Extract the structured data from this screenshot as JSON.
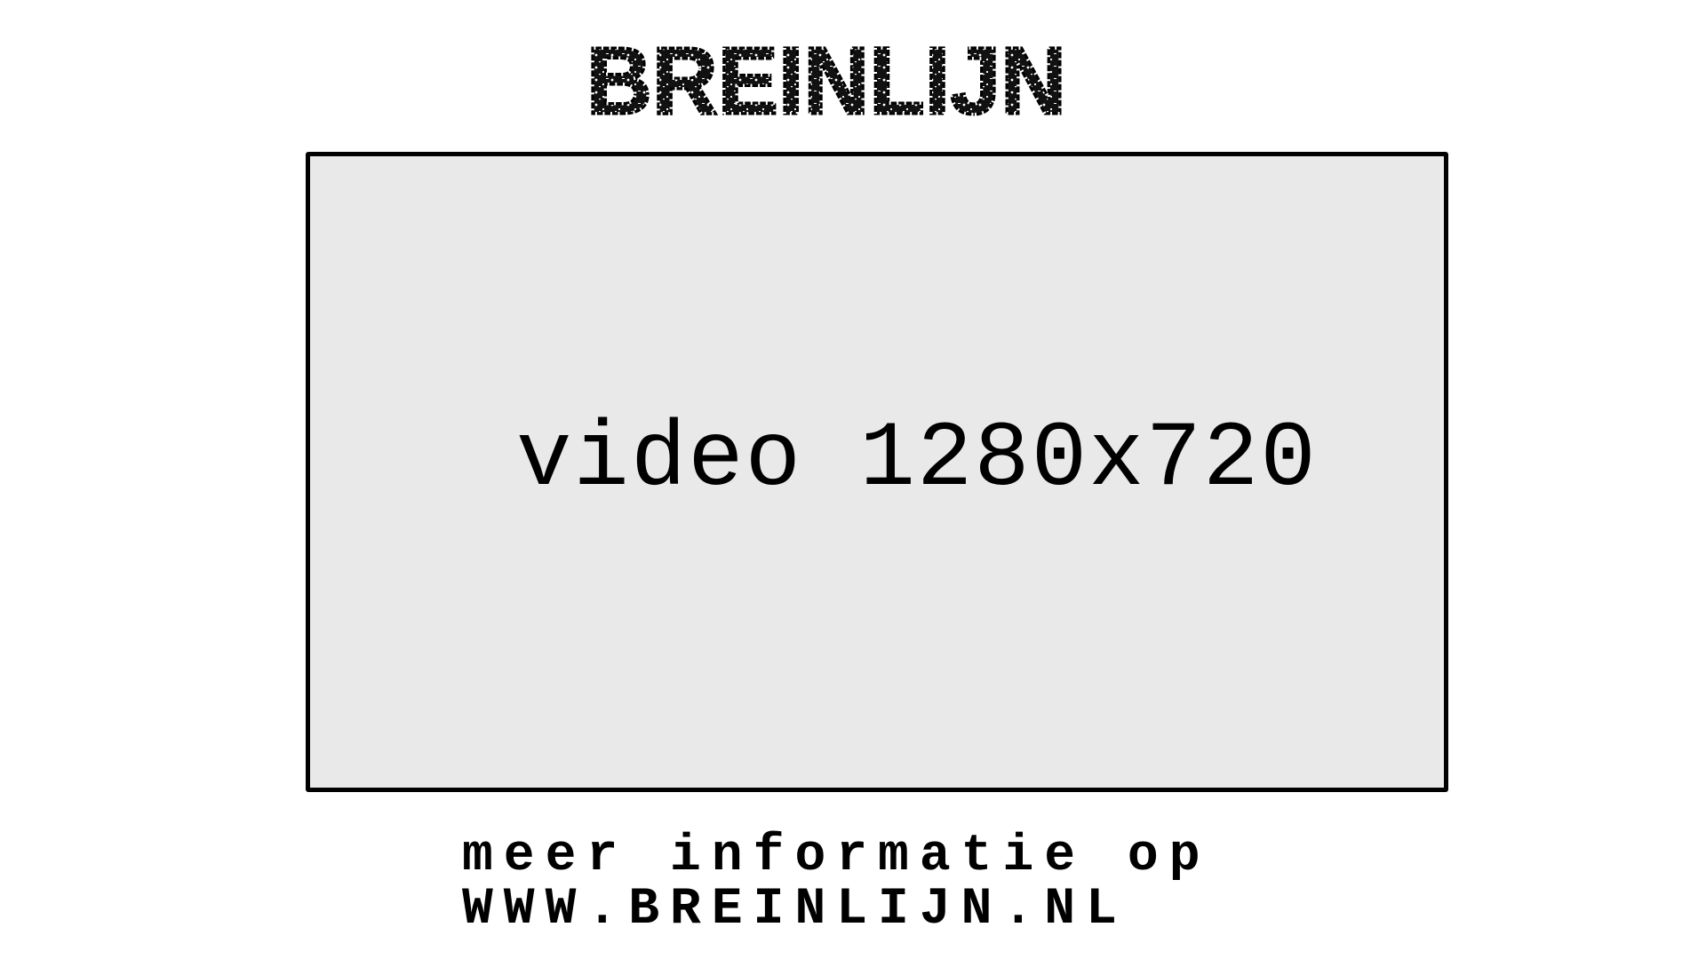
{
  "logo": {
    "text": "BREINLIJN"
  },
  "video": {
    "label": "video 1280x720",
    "fill_color": "#e9e9e9",
    "border_color": "#000000"
  },
  "info": {
    "line1": "meer informatie op",
    "line2": "WWW.BREINLIJN.NL"
  }
}
